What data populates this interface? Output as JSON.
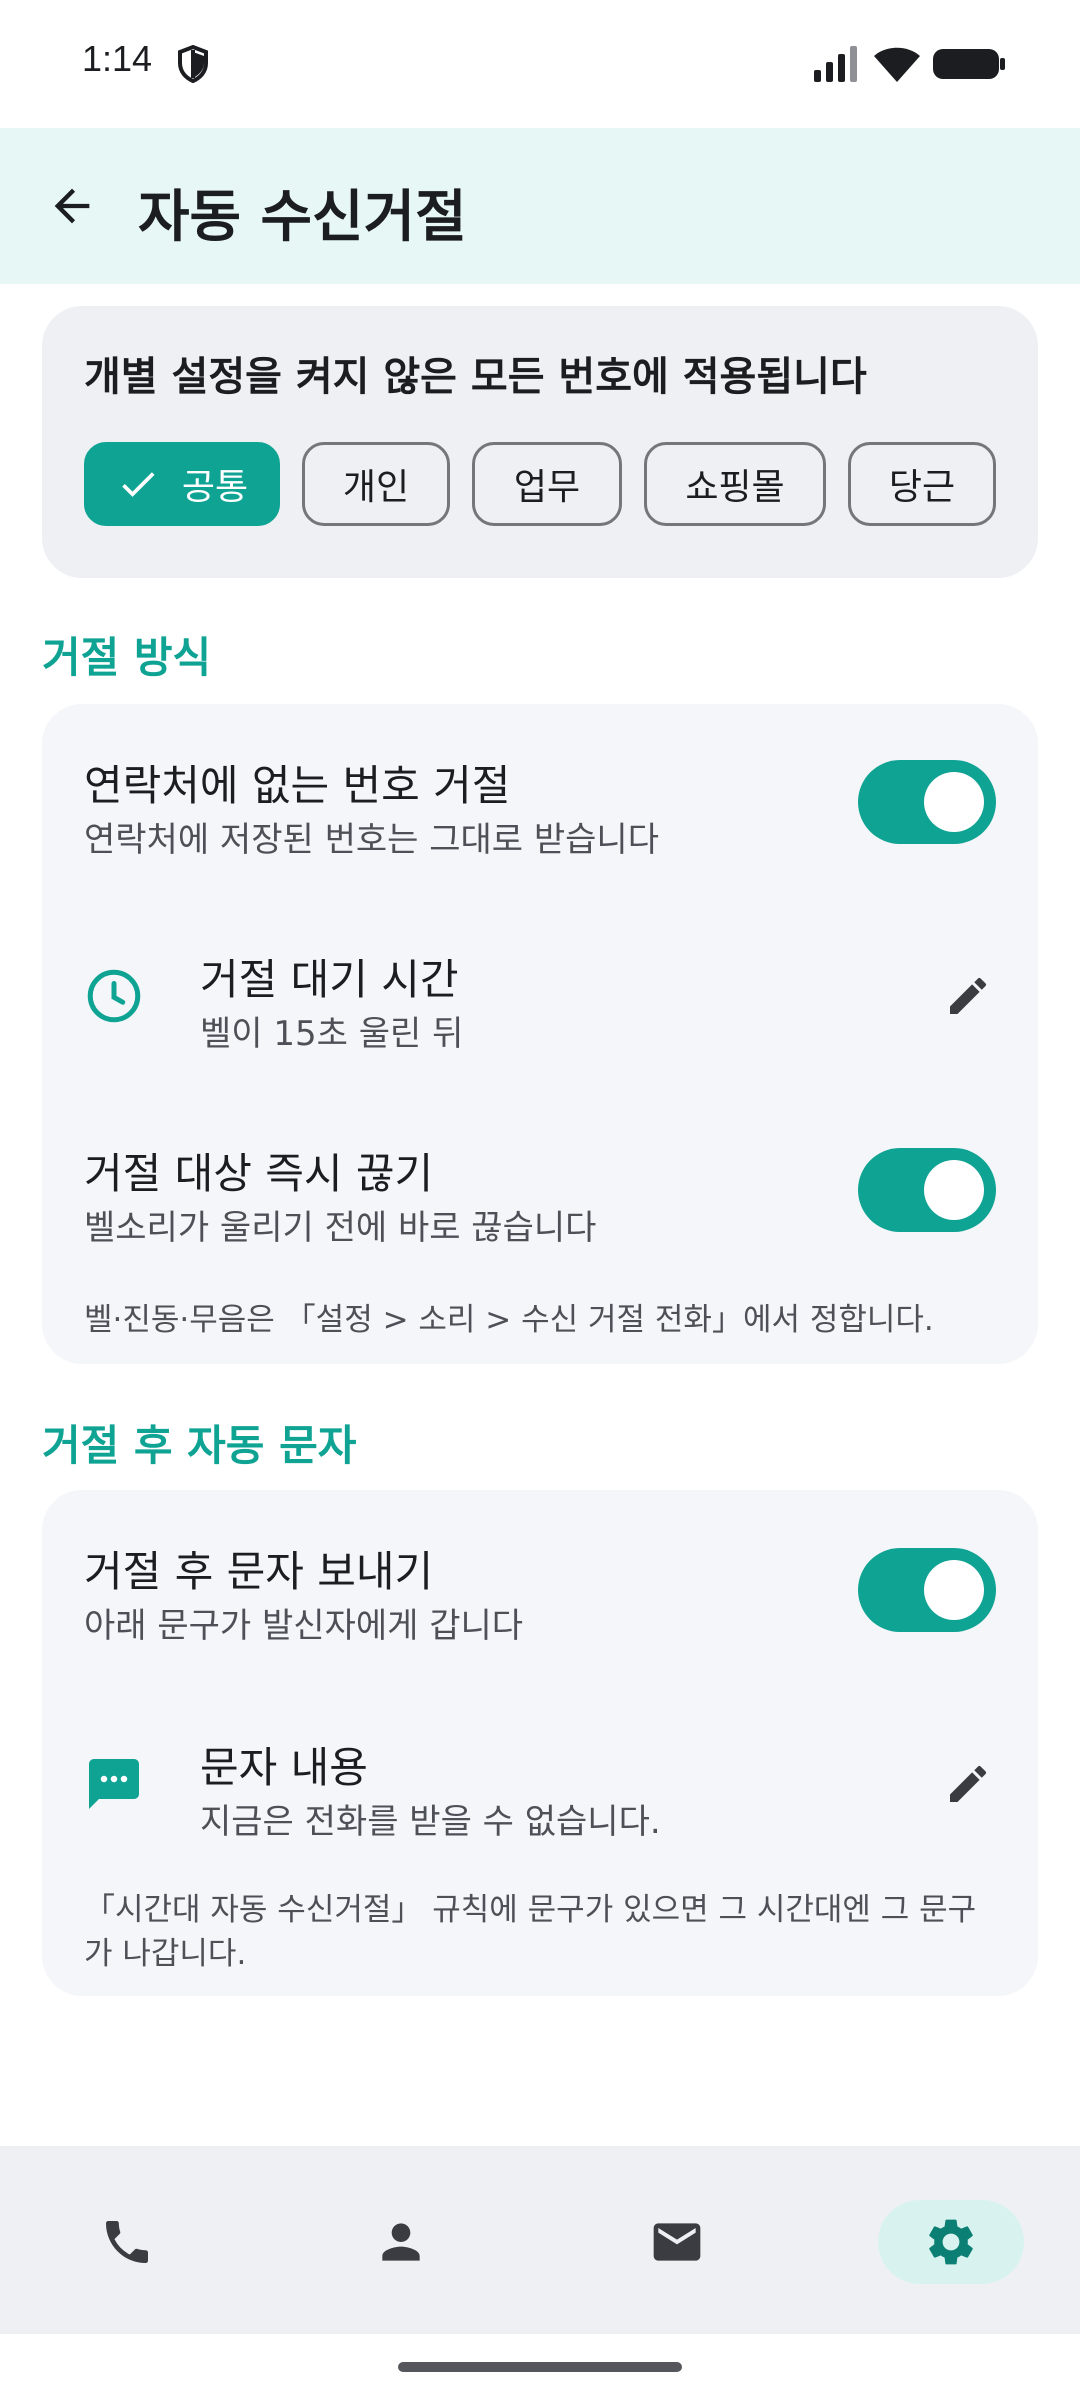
{
  "status_bar": {
    "time": "1:14"
  },
  "app_bar": {
    "title": "자동 수신거절"
  },
  "scope": {
    "description": "개별 설정을 켜지 않은 모든 번호에 적용됩니다",
    "chips": [
      {
        "label": "공통",
        "selected": true
      },
      {
        "label": "개인",
        "selected": false
      },
      {
        "label": "업무",
        "selected": false
      },
      {
        "label": "쇼핑몰",
        "selected": false
      },
      {
        "label": "당근",
        "selected": false
      }
    ]
  },
  "reject_method": {
    "section_title": "거절 방식",
    "unknown_numbers": {
      "title": "연락처에 없는 번호 거절",
      "subtitle": "연락처에 저장된 번호는 그대로 받습니다",
      "enabled": true
    },
    "wait_time": {
      "title": "거절 대기 시간",
      "subtitle": "벨이 15초 울린 뒤"
    },
    "hang_up_now": {
      "title": "거절 대상 즉시 끊기",
      "subtitle": "벨소리가 울리기 전에 바로 끊습니다",
      "enabled": true
    },
    "note": "벨·진동·무음은 「설정 > 소리 > 수신 거절 전화」에서 정합니다."
  },
  "auto_message": {
    "section_title": "거절 후 자동 문자",
    "send_message": {
      "title": "거절 후 문자 보내기",
      "subtitle": "아래 문구가 발신자에게 갑니다",
      "enabled": true
    },
    "message_content": {
      "title": "문자 내용",
      "subtitle": "지금은 전화를 받을 수 없습니다."
    },
    "note": "「시간대 자동 수신거절」 규칙에 문구가 있으면 그 시간대엔 그 문구가 나갑니다."
  },
  "bottom_nav": {
    "items": [
      {
        "icon": "phone-icon",
        "active": false
      },
      {
        "icon": "person-icon",
        "active": false
      },
      {
        "icon": "mail-icon",
        "active": false
      },
      {
        "icon": "gear-icon",
        "active": true
      }
    ]
  },
  "colors": {
    "accent": "#0fa394",
    "app_bar_bg": "#e6f7f5",
    "card_bg": "#f5f6f9",
    "active_nav_bg": "#d8f3ef"
  }
}
